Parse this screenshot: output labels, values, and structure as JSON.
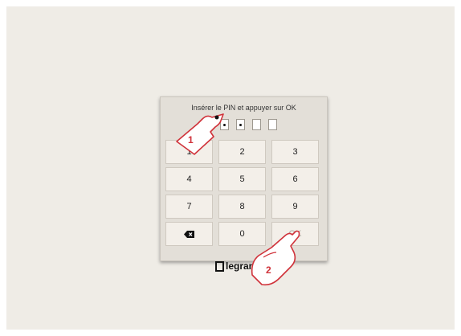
{
  "dialog": {
    "prompt": "Insérer le PIN et appuyer sur OK",
    "pin_boxes": [
      {
        "filled": true
      },
      {
        "filled": true
      },
      {
        "filled": true
      },
      {
        "filled": false
      },
      {
        "filled": false
      }
    ]
  },
  "keypad": {
    "keys": [
      {
        "label": "1",
        "icon": null
      },
      {
        "label": "2",
        "icon": null
      },
      {
        "label": "3",
        "icon": null
      },
      {
        "label": "4",
        "icon": null
      },
      {
        "label": "5",
        "icon": null
      },
      {
        "label": "6",
        "icon": null
      },
      {
        "label": "7",
        "icon": null
      },
      {
        "label": "8",
        "icon": null
      },
      {
        "label": "9",
        "icon": null
      },
      {
        "label": "",
        "icon": "backspace-icon"
      },
      {
        "label": "0",
        "icon": null
      },
      {
        "label": "OK",
        "icon": null
      }
    ]
  },
  "logo": {
    "text": "legrand"
  },
  "annotations": {
    "step1": "1",
    "step2": "2",
    "color": "#d0323a"
  }
}
